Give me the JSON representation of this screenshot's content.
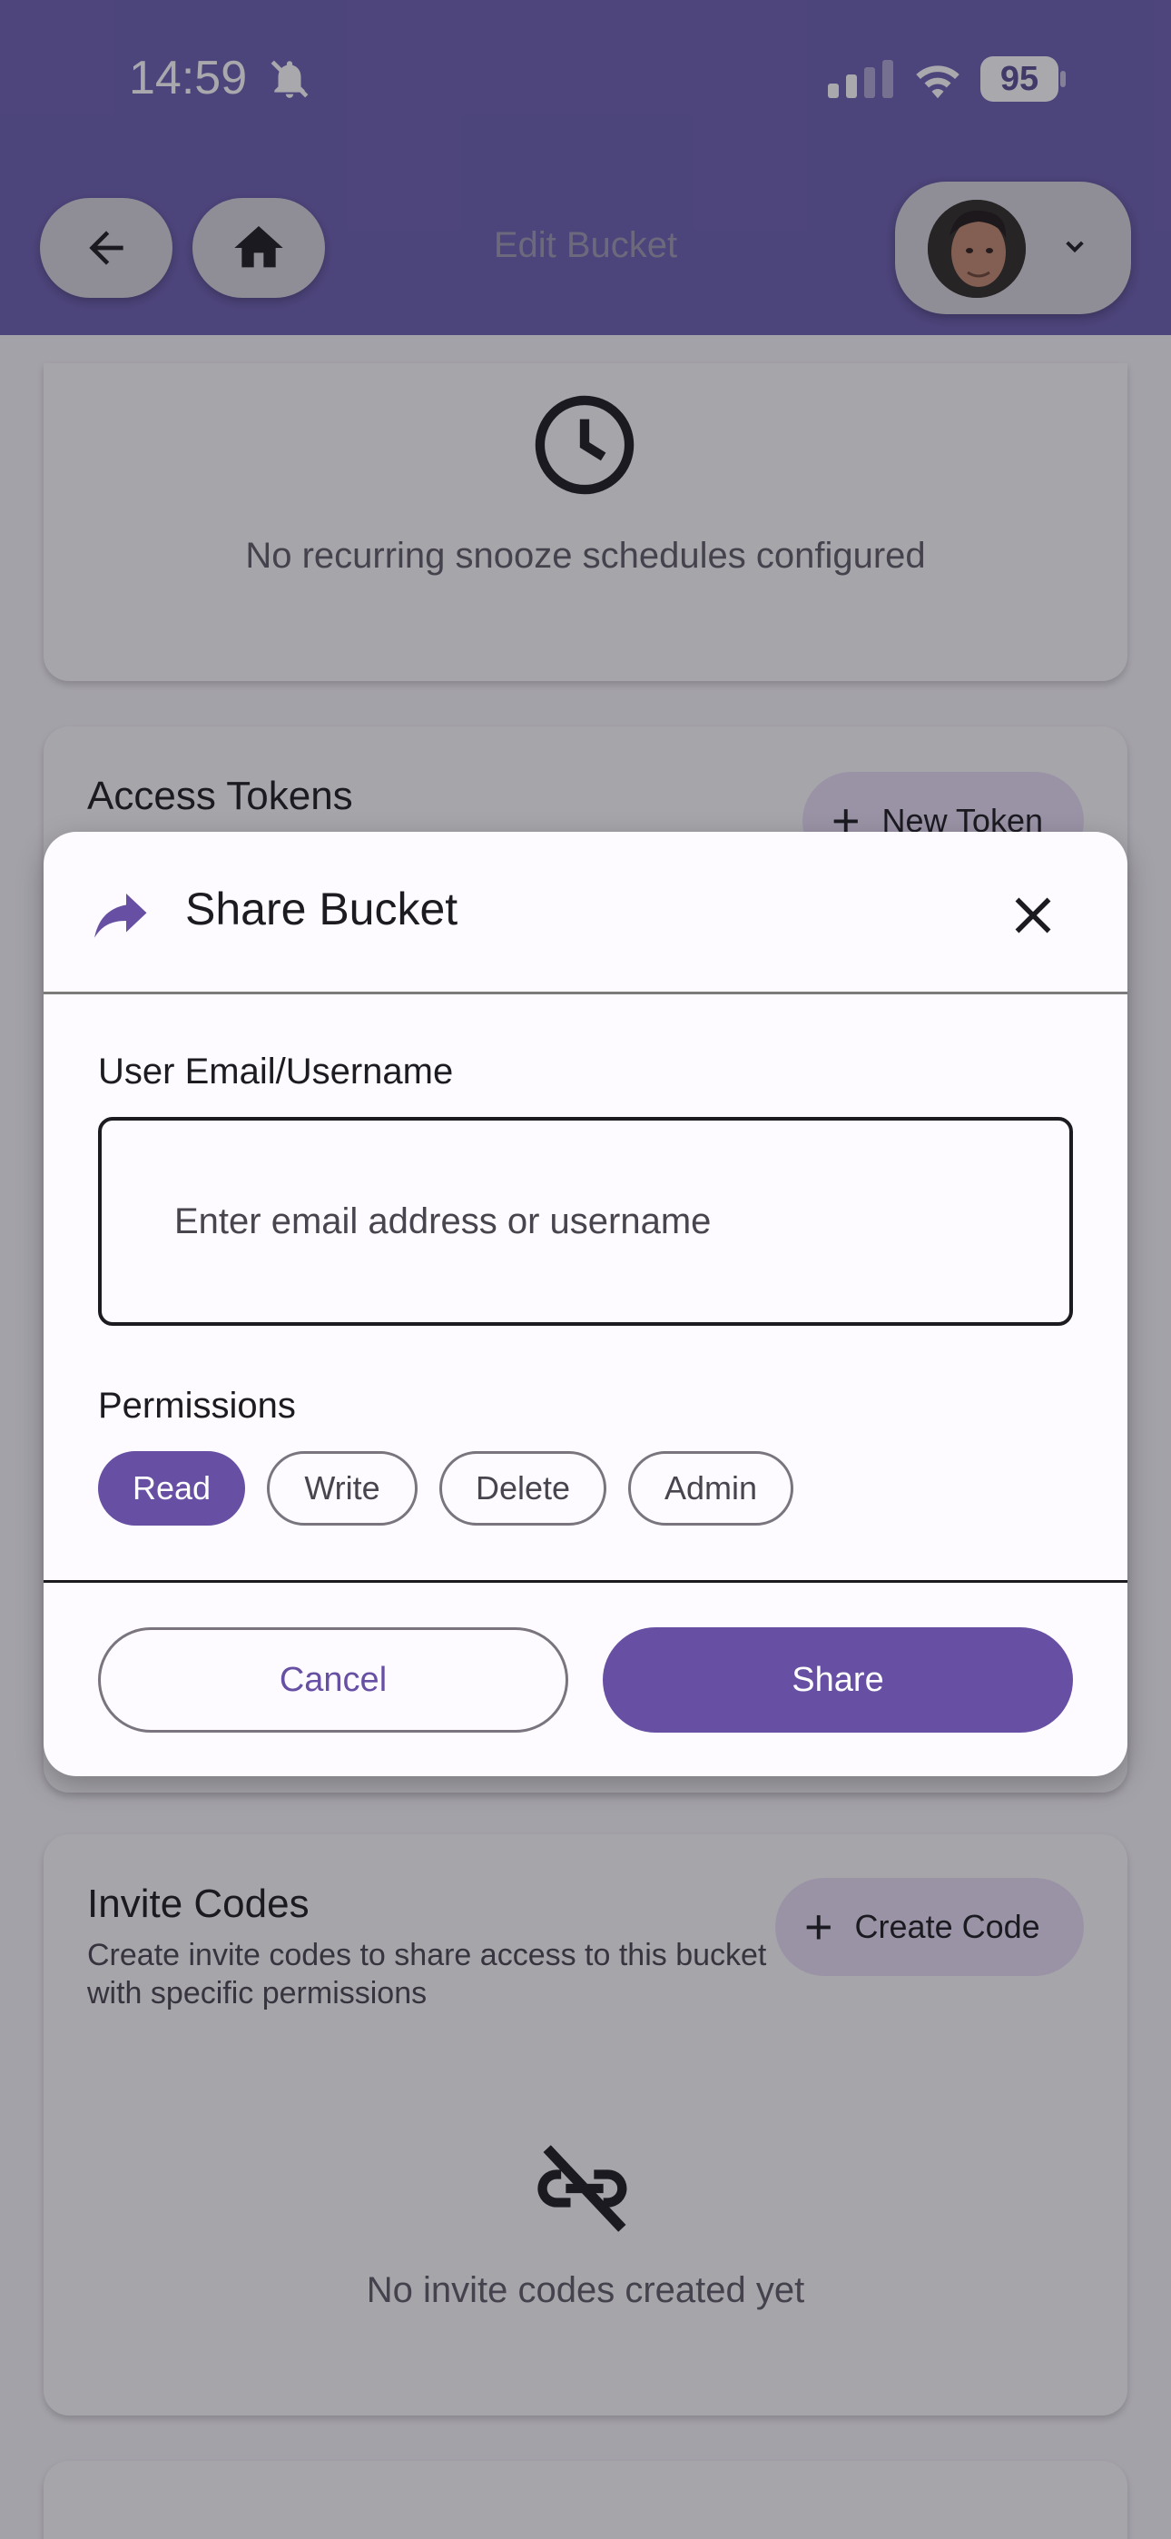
{
  "status_bar": {
    "time": "14:59",
    "battery": "95"
  },
  "app_bar": {
    "title": "Edit Bucket"
  },
  "snooze_card": {
    "empty_text": "No recurring snooze schedules configured"
  },
  "tokens_card": {
    "title": "Access Tokens",
    "new_token_label": "New Token"
  },
  "invite_card": {
    "title": "Invite Codes",
    "subtitle": "Create invite codes to share access to this bucket with specific permissions",
    "create_code_label": "Create Code",
    "empty_text": "No invite codes created yet"
  },
  "dialog": {
    "title": "Share Bucket",
    "email_label": "User Email/Username",
    "email_value": "",
    "email_placeholder": "Enter email address or username",
    "permissions_label": "Permissions",
    "permissions": [
      {
        "label": "Read",
        "selected": true
      },
      {
        "label": "Write",
        "selected": false
      },
      {
        "label": "Delete",
        "selected": false
      },
      {
        "label": "Admin",
        "selected": false
      }
    ],
    "cancel_label": "Cancel",
    "share_label": "Share"
  },
  "colors": {
    "primary": "#6750a4",
    "app_bar": "#6a5fb0",
    "surface": "#fdfbff",
    "chip_border": "#79747e"
  }
}
